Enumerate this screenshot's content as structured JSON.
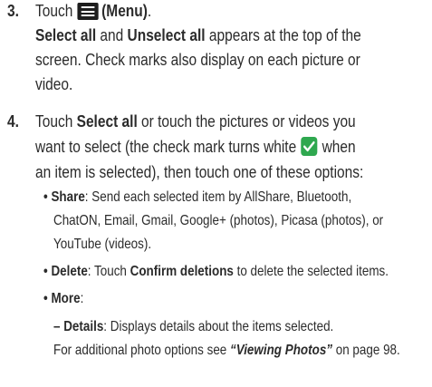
{
  "step3": {
    "number": "3.",
    "text_before": "Touch",
    "menu_label": "(Menu)",
    "period": ".",
    "line2_b1": "Select all",
    "line2_mid": " and ",
    "line2_b2": "Unselect all",
    "line2_rest": " appears at the top of the",
    "line3": "screen. Check marks also display on each picture or",
    "line4": "video."
  },
  "step4": {
    "number": "4.",
    "line1_pre": "Touch ",
    "line1_bold": "Select all",
    "line1_rest": " or touch the pictures or videos you",
    "line2_pre": "want to select (the check mark turns white",
    "line2_post": "when",
    "line3": "an item is selected), then touch one of these options:",
    "share_bullet": "•",
    "share_label": "Share",
    "share_line1": ": Send each selected item by AllShare, Bluetooth,",
    "share_line2": "ChatON, Email, Gmail, Google+ (photos), Picasa (photos), or",
    "share_line3": "YouTube (videos).",
    "delete_bullet": "•",
    "delete_label": "Delete",
    "delete_pre": ": Touch ",
    "delete_bold": "Confirm deletions",
    "delete_rest": " to delete the selected items.",
    "more_bullet": "•",
    "more_label": "More",
    "more_colon": ":",
    "details_dash": "–",
    "details_label": "Details",
    "details_rest": ": Displays details about the items selected.",
    "footer_pre": "For additional photo options see ",
    "footer_ref": "“Viewing Photos”",
    "footer_post": " on page 98."
  },
  "icons": {
    "menu": "menu-icon",
    "check": "checkmark-icon",
    "check_color": "#2fa84f"
  }
}
